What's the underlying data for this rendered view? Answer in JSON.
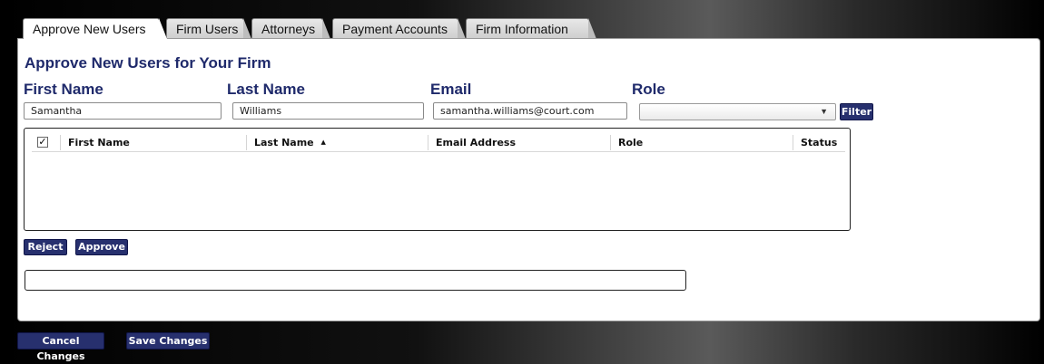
{
  "tabs": [
    {
      "label": "Approve New Users",
      "active": true
    },
    {
      "label": "Firm Users",
      "active": false
    },
    {
      "label": "Attorneys",
      "active": false
    },
    {
      "label": "Payment Accounts",
      "active": false
    },
    {
      "label": "Firm Information",
      "active": false
    }
  ],
  "page": {
    "title": "Approve New Users for Your Firm"
  },
  "filters": {
    "first_name": {
      "label": "First Name",
      "value": "Samantha"
    },
    "last_name": {
      "label": "Last Name",
      "value": "Williams"
    },
    "email": {
      "label": "Email",
      "value": "samantha.williams@court.com"
    },
    "role": {
      "label": "Role",
      "selected": ""
    },
    "filter_button": "Filter"
  },
  "grid": {
    "columns": [
      "First Name",
      "Last Name",
      "Email Address",
      "Role",
      "Status"
    ],
    "sort_indicator": "▲",
    "select_all_checked": true,
    "rows": []
  },
  "actions": {
    "reject": "Reject",
    "approve": "Approve"
  },
  "message": "",
  "footer": {
    "cancel": "Cancel Changes",
    "save": "Save Changes"
  },
  "icons": {
    "checkbox": "checkmark-icon",
    "dropdown": "chevron-down-icon",
    "sort": "sort-ascending-icon"
  },
  "colors": {
    "heading": "#1f2a6b",
    "button": "#27306e"
  }
}
